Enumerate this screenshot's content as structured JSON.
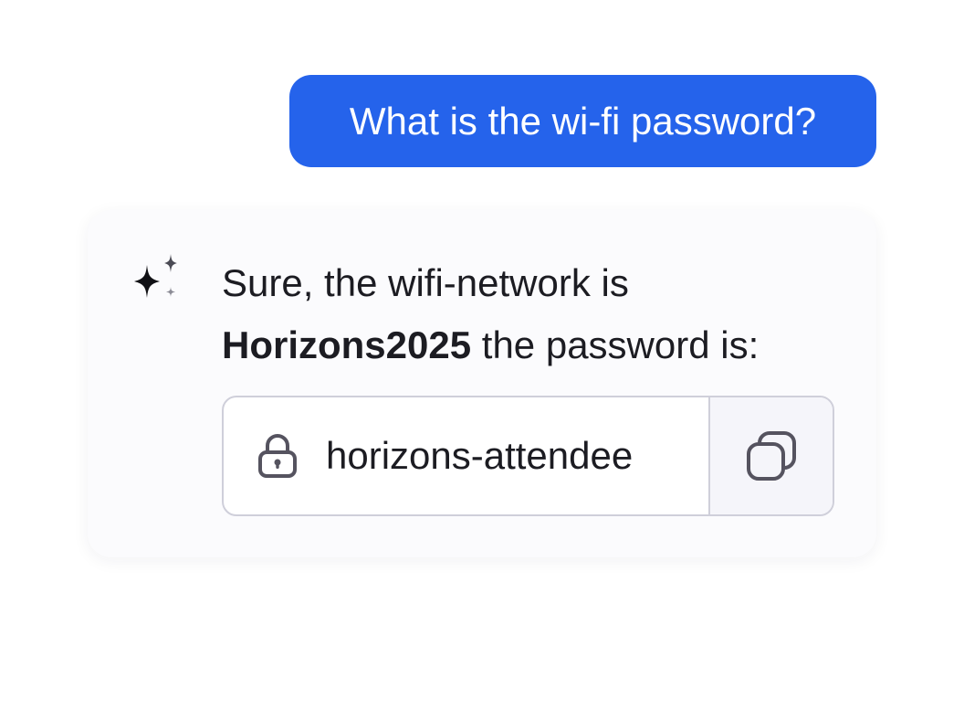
{
  "user_message": {
    "text": "What is the wi-fi password?"
  },
  "assistant_message": {
    "icon": "sparkle-icon",
    "line1": "Sure, the wifi-network is",
    "network_name": "Horizons2025",
    "line2_suffix": " the password is:"
  },
  "password_field": {
    "icon": "lock-icon",
    "value": "horizons-attendee",
    "copy_icon": "copy-icon"
  },
  "colors": {
    "user_bubble": "#2563eb",
    "card_background": "#fbfbfd",
    "text": "#1c1c22",
    "border": "#cfcfda",
    "icon_gray": "#55535f"
  }
}
